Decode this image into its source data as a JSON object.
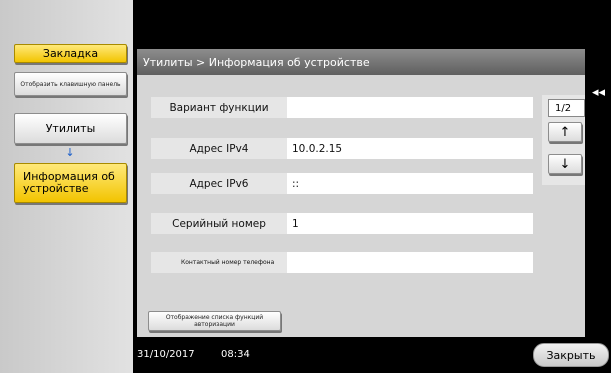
{
  "sidebar": {
    "bookmark": "Закладка",
    "show_keypad": "Отобразить клавишную панель",
    "utilities": "Утилиты",
    "flow_arrow": "↓",
    "device_info": "Информация об устройстве"
  },
  "panel": {
    "breadcrumb": "Утилиты > Информация об устройстве",
    "rows": [
      {
        "label": "Вариант функции",
        "value": ""
      },
      {
        "label": "Адрес IPv4",
        "value": "10.0.2.15"
      },
      {
        "label": "Адрес IPv6",
        "value": "::"
      },
      {
        "label": "Серийный номер",
        "value": "1"
      },
      {
        "label": "Контактный номер телефона",
        "value": ""
      }
    ],
    "auth_list_button": "Отображение списка функций авторизации"
  },
  "pager": {
    "page_indicator": "1/2",
    "up_symbol": "↑",
    "down_symbol": "↓"
  },
  "back_tab_symbol": "◂◂",
  "status": {
    "date": "31/10/2017",
    "time": "08:34"
  },
  "close_button": "Закрыть",
  "colors": {
    "accent_yellow": "#f2c400",
    "title_bar": "#6e6e6e",
    "panel_bg": "#d6d6d6"
  }
}
